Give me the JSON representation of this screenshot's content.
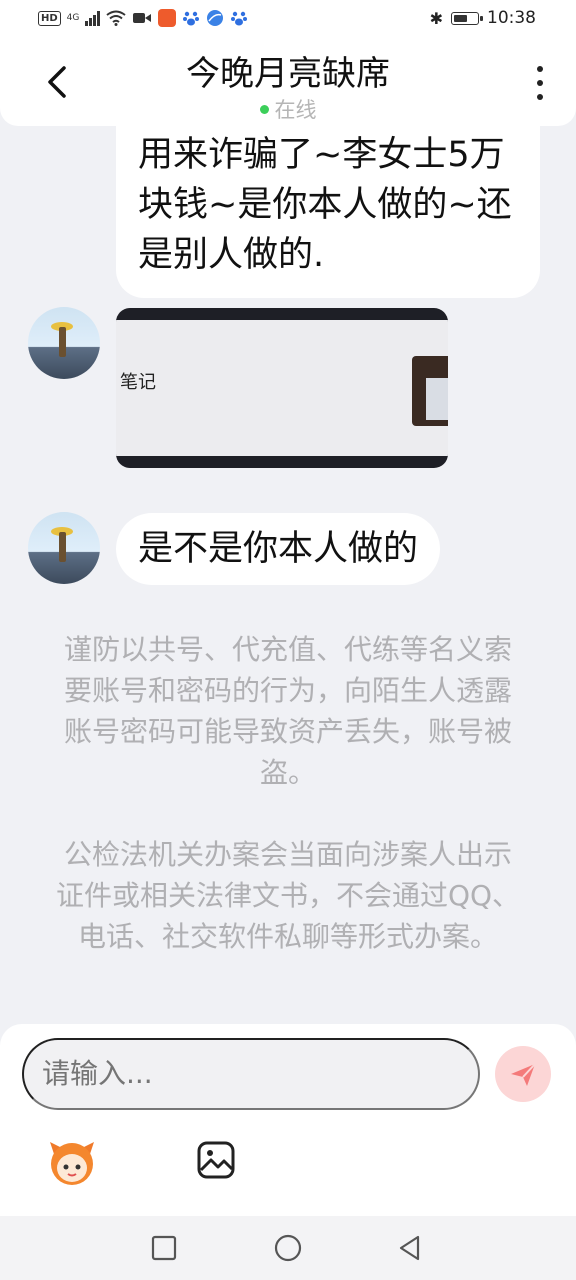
{
  "status_bar": {
    "hd_badge": "HD",
    "network": "4G",
    "bluetooth": "✱",
    "time": "10:38",
    "battery_level": 0.6,
    "app_icons": [
      "video-icon",
      "app-badge-icon",
      "paw-icon",
      "globe-icon",
      "paw-icon"
    ]
  },
  "header": {
    "title": "今晚月亮缺席",
    "status": "在线",
    "status_color": "#3ccf5a"
  },
  "messages": {
    "self_text": "用来诈骗了~李女士5万块钱~是你本人做的~还是别人做的.",
    "image_note": "笔记",
    "other_text": "是不是你本人做的"
  },
  "notices": {
    "first": "谨防以共号、代充值、代练等名义索要账号和密码的行为，向陌生人透露账号密码可能导致资产丢失，账号被盗。",
    "second": "公检法机关办案会当面向涉案人出示证件或相关法律文书，不会通过QQ、电话、社交软件私聊等形式办案。"
  },
  "input": {
    "placeholder": "请输入..."
  },
  "colors": {
    "background": "#f0f1f5",
    "send_button": "#fcd6d6",
    "send_icon": "#f47a7a"
  }
}
